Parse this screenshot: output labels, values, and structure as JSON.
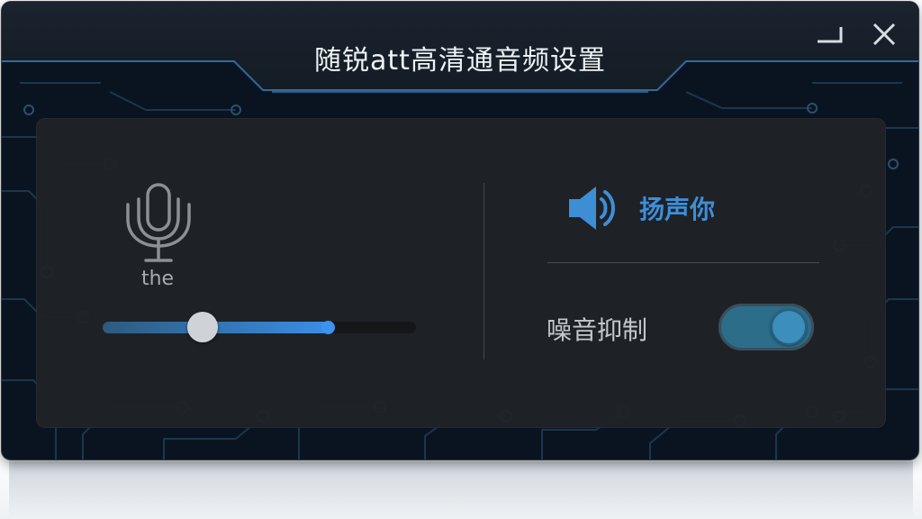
{
  "window": {
    "title": "随锐att高清通音频设置"
  },
  "microphone": {
    "icon": "microphone-icon",
    "label": "the",
    "volume": {
      "thumb_percent": 32,
      "fill_percent": 72
    }
  },
  "speaker": {
    "icon": "speaker-icon",
    "label": "扬声你"
  },
  "noise_suppression": {
    "label": "噪音抑制",
    "enabled": true
  },
  "colors": {
    "accent": "#3e8ed6",
    "toggle_on": "#2c6d8a",
    "panel": "#202226",
    "background": "#0a1420"
  }
}
